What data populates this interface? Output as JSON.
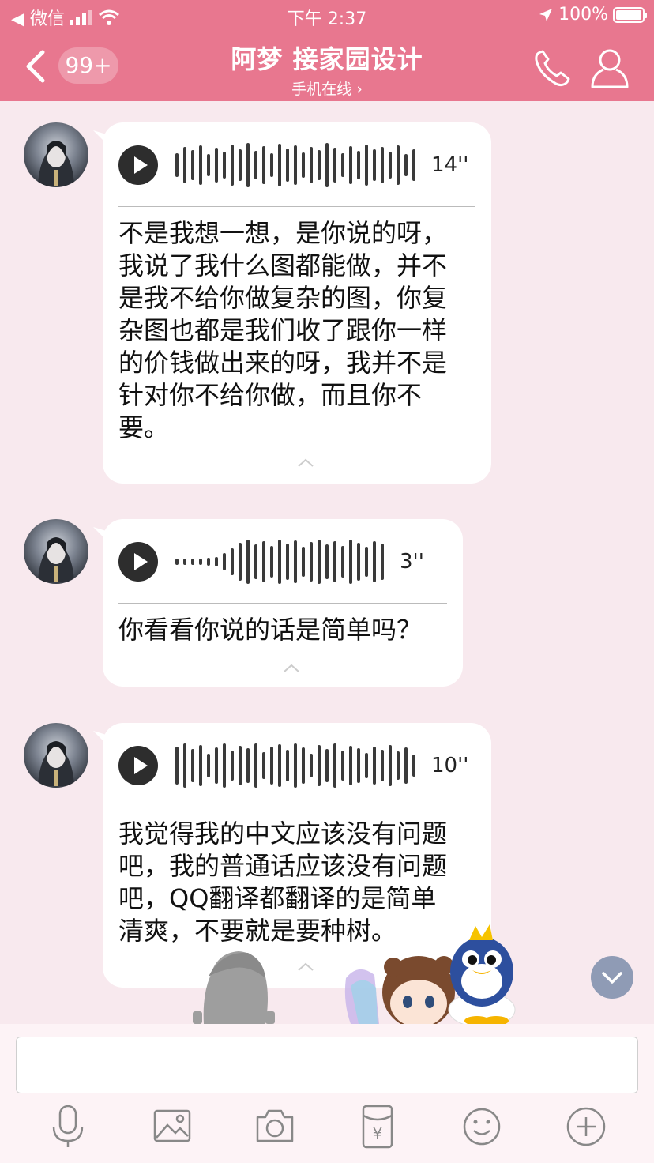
{
  "status_bar": {
    "carrier": "◀ 微信",
    "time": "下午 2:37",
    "battery": "100%"
  },
  "nav": {
    "badge": "99+",
    "title": "阿梦 接家园设计",
    "subtitle": "手机在线 ›"
  },
  "messages": [
    {
      "duration": "14''",
      "text": [
        "不是我想一想，是你说的呀，",
        "我说了我什么图都能做，并不",
        "是我不给你做复杂的图，你复",
        "杂图也都是我们收了跟你一样",
        "的价钱做出来的呀，我并不是",
        "针对你不给你做，而且你不",
        "要。"
      ]
    },
    {
      "duration": "3''",
      "text": [
        "你看看你说的话是简单吗？"
      ]
    },
    {
      "duration": "10''",
      "text": [
        "我觉得我的中文应该没有问题",
        "吧，我的普通话应该没有问题",
        "吧，QQ翻译都翻译的是简单",
        "清爽，不要就是要种树。"
      ]
    }
  ],
  "icons": {
    "back": "chevron-left-icon",
    "phone": "phone-icon",
    "profile": "person-icon",
    "play": "play-icon",
    "scroll_down": "chevron-down-icon",
    "toolbar": [
      "microphone-icon",
      "image-icon",
      "camera-icon",
      "red-packet-icon",
      "emoji-icon",
      "plus-icon"
    ]
  },
  "colors": {
    "accent": "#e8778f",
    "background": "#f8e9ee",
    "bubble": "#ffffff"
  }
}
